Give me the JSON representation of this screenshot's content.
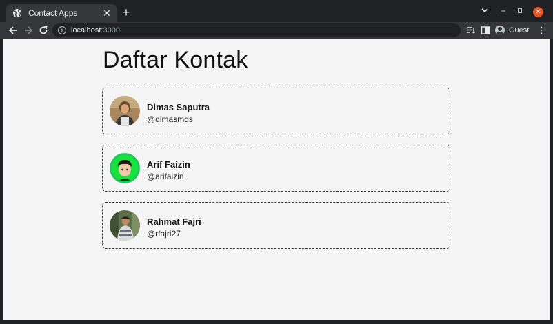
{
  "browser": {
    "tab_title": "Contact Apps",
    "tab_close": "✕",
    "new_tab": "+",
    "url_host": "localhost",
    "url_port": ":3000",
    "profile_label": "Guest"
  },
  "page": {
    "title": "Daftar Kontak",
    "contacts": [
      {
        "name": "Dimas Saputra",
        "handle": "@dimasmds"
      },
      {
        "name": "Arif Faizin",
        "handle": "@arifaizin"
      },
      {
        "name": "Rahmat Fajri",
        "handle": "@rfajri27"
      }
    ]
  },
  "colors": {
    "page_background": "#f5f5f5",
    "browser_frame": "#202124",
    "toolbar": "#35363a",
    "close_button": "#e95420",
    "avatar_green": "#22c55e"
  }
}
